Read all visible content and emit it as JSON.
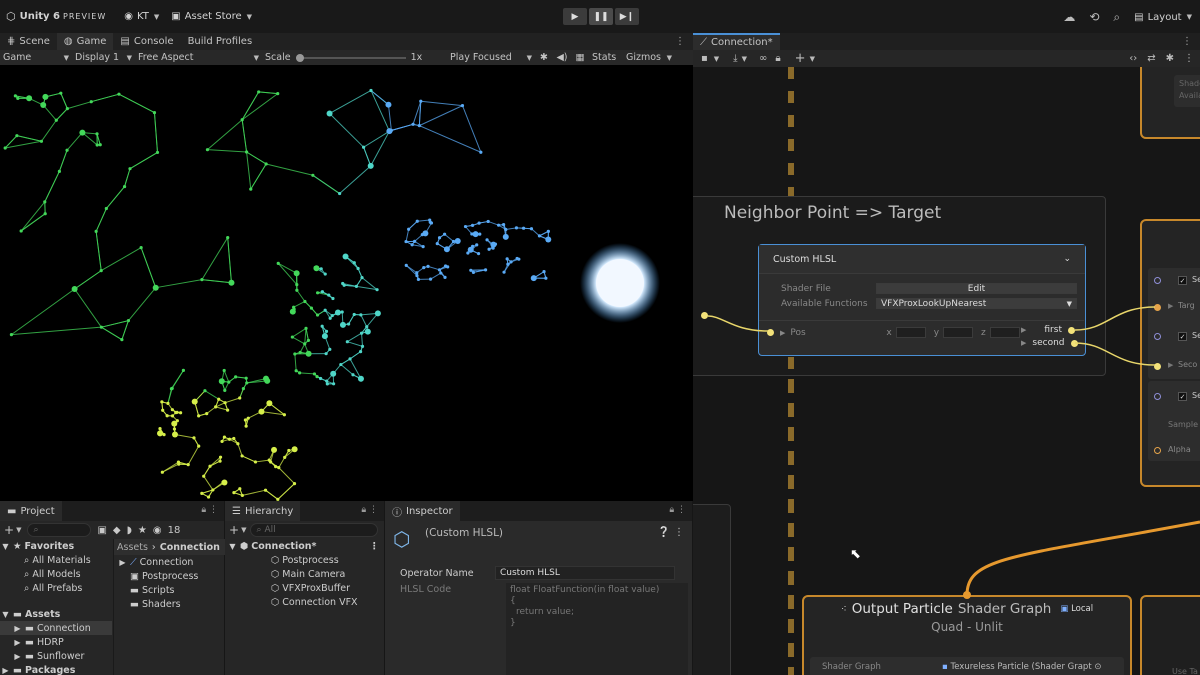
{
  "topbar": {
    "unity_label": "Unity 6",
    "preview_label": "PREVIEW",
    "account": "KT",
    "asset_store": "Asset Store",
    "layout": "Layout"
  },
  "scene_tabs": {
    "scene": "Scene",
    "game": "Game",
    "console": "Console",
    "build_profiles": "Build Profiles"
  },
  "game_toolbar": {
    "mode": "Game",
    "display": "Display 1",
    "aspect": "Free Aspect",
    "scale_label": "Scale",
    "scale_value": "1x",
    "play_focused": "Play Focused",
    "stats": "Stats",
    "gizmos": "Gizmos"
  },
  "project": {
    "tab": "Project",
    "count": "18",
    "favorites": "Favorites",
    "fav_items": [
      "All Materials",
      "All Models",
      "All Prefabs"
    ],
    "assets": "Assets",
    "asset_folders": [
      "Connection",
      "HDRP",
      "Sunflower"
    ],
    "packages": "Packages",
    "breadcrumb_root": "Assets",
    "breadcrumb_current": "Connection",
    "files": [
      "Connection",
      "Postprocess",
      "Scripts",
      "Shaders"
    ]
  },
  "hierarchy": {
    "tab": "Hierarchy",
    "search_placeholder": "All",
    "scene": "Connection*",
    "items": [
      "Postprocess",
      "Main Camera",
      "VFXProxBuffer",
      "Connection VFX"
    ]
  },
  "inspector": {
    "tab": "Inspector",
    "title": "(Custom HLSL)",
    "operator_name_label": "Operator Name",
    "operator_name_value": "Custom HLSL",
    "hlsl_code_label": "HLSL Code",
    "code_line1": "float FloatFunction(in float value)",
    "code_line2": "{",
    "code_line3": "return value;",
    "code_line4": "}"
  },
  "graph": {
    "tab": "Connection*",
    "group_title": "Neighbor Point => Target",
    "node_title": "Custom HLSL",
    "shader_file_label": "Shader File",
    "edit_button": "Edit",
    "available_functions_label": "Available Functions",
    "available_functions_value": "VFXProxLookUpNearest",
    "pos_label": "Pos",
    "x_label": "x",
    "y_label": "y",
    "z_label": "z",
    "out_first": "first",
    "out_second": "second",
    "output_title": "Output Particle",
    "output_subtitle_type": "Shader Graph",
    "output_local": "Local",
    "output_mode": "Quad - Unlit",
    "shader_graph_label": "Shader Graph",
    "shader_graph_value": "Texureless Particle (Shader Grapt",
    "right_use_t": "Use Ta",
    "right_shader": "Shader",
    "right_availab": "Availab",
    "right_targ": "Targ",
    "right_seco": "Seco",
    "right_sample": "Sample",
    "right_alpha": "Alpha",
    "right_se": "Se"
  },
  "colors": {
    "accent_blue": "#4a90d6",
    "port_yellow": "#f3e27a",
    "frame_orange": "#c7882b"
  }
}
